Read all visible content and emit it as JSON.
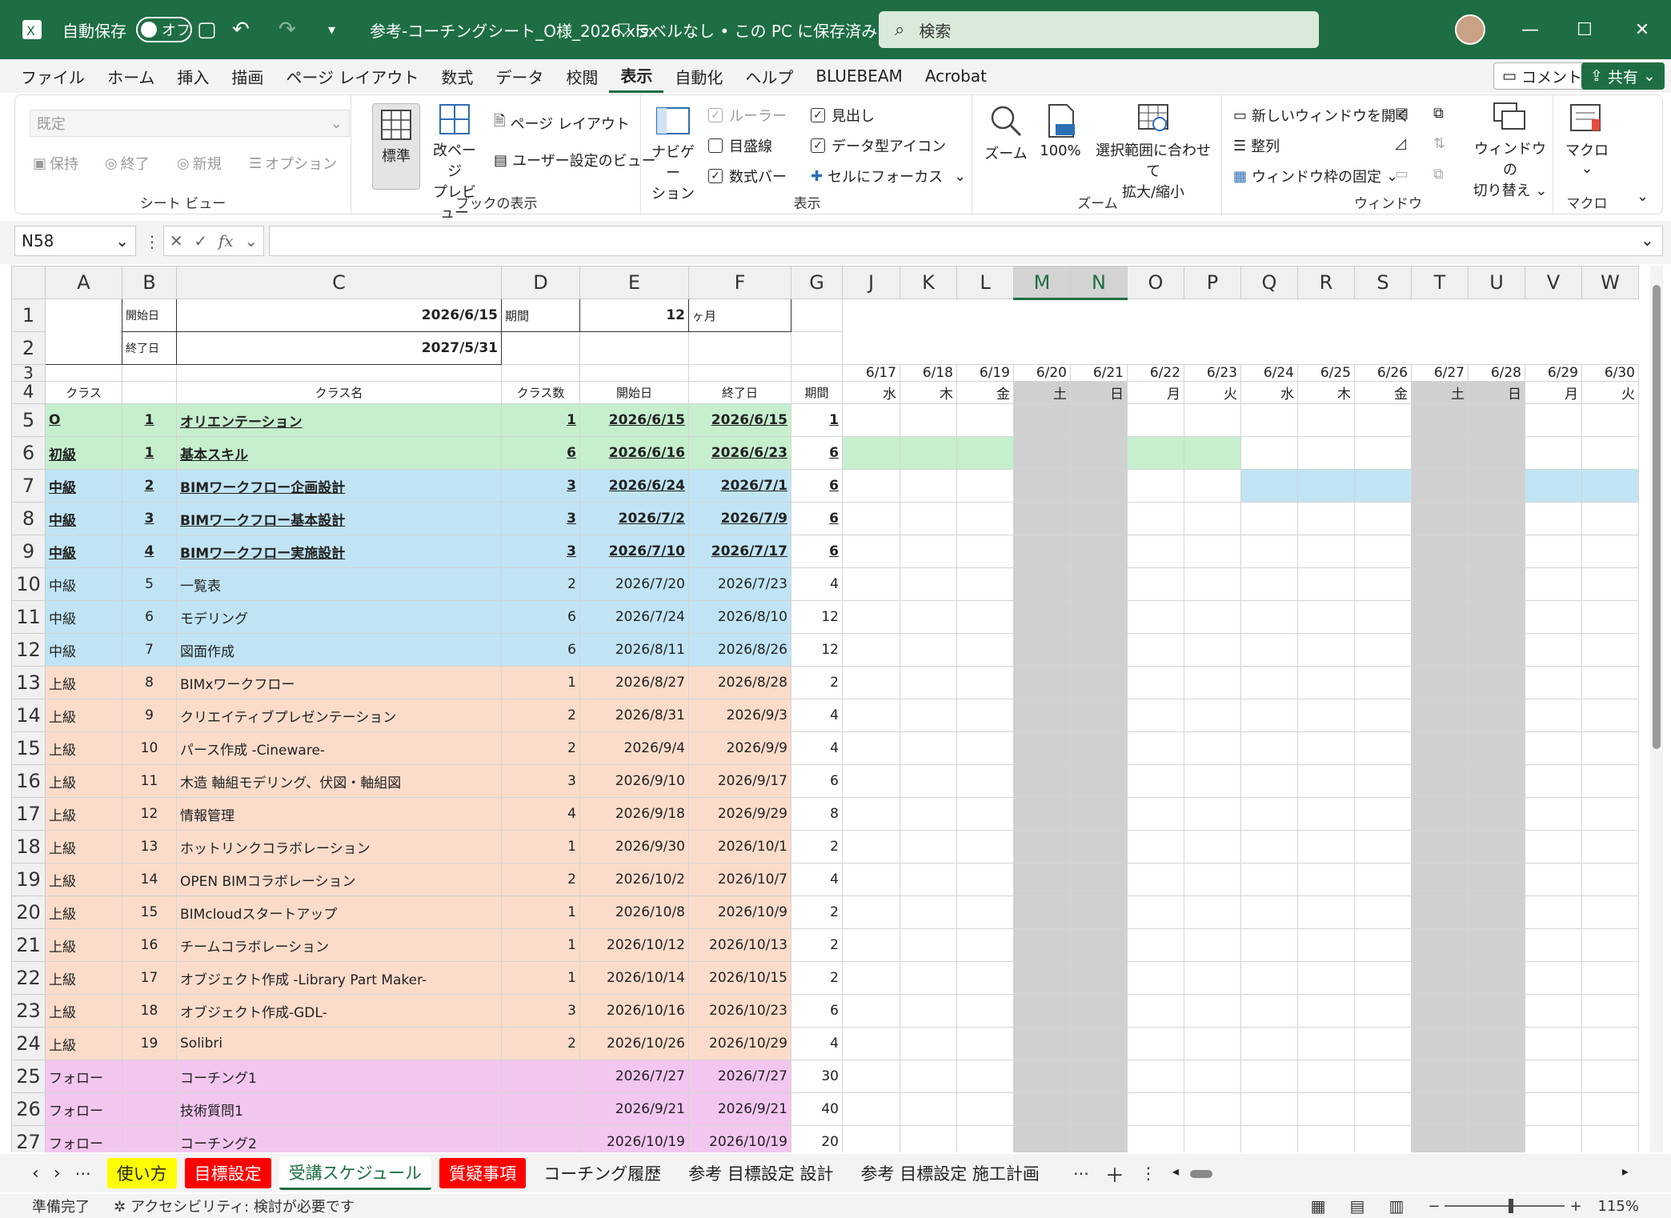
{
  "title_bar": {
    "autosave": "自動保存",
    "toggle": "オフ",
    "filename": "参考-コーチングシート_O様_2026.xlsx",
    "label": "ラベルなし • この PC に保存済み",
    "search": "検索"
  },
  "menu": [
    "ファイル",
    "ホーム",
    "挿入",
    "描画",
    "ページ レイアウト",
    "数式",
    "データ",
    "校閲",
    "表示",
    "自動化",
    "ヘルプ",
    "BLUEBEAM",
    "Acrobat"
  ],
  "menu_buttons": {
    "comment": "コメント",
    "share": "共有"
  },
  "ribbon": {
    "sheetview": {
      "select": "既定",
      "keep": "保持",
      "exit": "終了",
      "new": "新規",
      "options": "オプション",
      "label": "シート ビュー"
    },
    "book": {
      "normal": "標準",
      "pagebreak1": "改ページ",
      "pagebreak2": "プレビュー",
      "pagelayout": "ページ レイアウト",
      "custom": "ユーザー設定のビュー",
      "label": "ブックの表示"
    },
    "show": {
      "nav1": "ナビゲー",
      "nav2": "ション",
      "ruler": "ルーラー",
      "gridlines": "目盛線",
      "formulabar": "数式バー",
      "headings": "見出し",
      "datatype": "データ型アイコン",
      "focus": "セルにフォーカス",
      "label": "表示"
    },
    "zoom": {
      "zoom": "ズーム",
      "hundred": "100%",
      "sel1": "選択範囲に合わせて",
      "sel2": "拡大/縮小",
      "label": "ズーム"
    },
    "window": {
      "newwin": "新しいウィンドウを開く",
      "arrange": "整列",
      "freeze": "ウィンドウ枠の固定",
      "switch1": "ウィンドウの",
      "switch2": "切り替え",
      "label": "ウィンドウ"
    },
    "macro": {
      "macro": "マクロ",
      "label": "マクロ"
    }
  },
  "namebox": "N58",
  "fx": "fx",
  "col_headers": [
    "A",
    "B",
    "C",
    "D",
    "E",
    "F",
    "G",
    "J",
    "K",
    "L",
    "M",
    "N",
    "O",
    "P",
    "Q",
    "R",
    "S",
    "T",
    "U",
    "V",
    "W"
  ],
  "row1": {
    "rn": "1",
    "b": "開始日",
    "c": "2026/6/15",
    "d": "期間",
    "e": "12",
    "f": "ヶ月"
  },
  "row2": {
    "rn": "2",
    "b": "終了日",
    "c": "2027/5/31"
  },
  "row3": {
    "rn": "3",
    "dates": [
      "6/17",
      "6/18",
      "6/19",
      "6/20",
      "6/21",
      "6/22",
      "6/23",
      "6/24",
      "6/25",
      "6/26",
      "6/27",
      "6/28",
      "6/29",
      "6/30"
    ]
  },
  "row4": {
    "rn": "4",
    "a": "クラス",
    "c": "クラス名",
    "d": "クラス数",
    "e": "開始日",
    "f": "終了日",
    "g": "期間",
    "days": [
      "水",
      "木",
      "金",
      "土",
      "日",
      "月",
      "火",
      "水",
      "木",
      "金",
      "土",
      "日",
      "月",
      "火"
    ]
  },
  "rows": [
    {
      "rn": "5",
      "a": "O",
      "b": "1",
      "c": "オリエンテーション",
      "d": "1",
      "e": "2026/6/15",
      "f": "2026/6/15",
      "g": "1"
    },
    {
      "rn": "6",
      "a": "初級",
      "b": "1",
      "c": "基本スキル",
      "d": "6",
      "e": "2026/6/16",
      "f": "2026/6/23",
      "g": "6"
    },
    {
      "rn": "7",
      "a": "中級",
      "b": "2",
      "c": "BIMワークフロー企画設計",
      "d": "3",
      "e": "2026/6/24",
      "f": "2026/7/1",
      "g": "6"
    },
    {
      "rn": "8",
      "a": "中級",
      "b": "3",
      "c": "BIMワークフロー基本設計",
      "d": "3",
      "e": "2026/7/2",
      "f": "2026/7/9",
      "g": "6"
    },
    {
      "rn": "9",
      "a": "中級",
      "b": "4",
      "c": "BIMワークフロー実施設計",
      "d": "3",
      "e": "2026/7/10",
      "f": "2026/7/17",
      "g": "6"
    },
    {
      "rn": "10",
      "a": "中級",
      "b": "5",
      "c": "一覧表",
      "d": "2",
      "e": "2026/7/20",
      "f": "2026/7/23",
      "g": "4"
    },
    {
      "rn": "11",
      "a": "中級",
      "b": "6",
      "c": "モデリング",
      "d": "6",
      "e": "2026/7/24",
      "f": "2026/8/10",
      "g": "12"
    },
    {
      "rn": "12",
      "a": "中級",
      "b": "7",
      "c": "図面作成",
      "d": "6",
      "e": "2026/8/11",
      "f": "2026/8/26",
      "g": "12"
    },
    {
      "rn": "13",
      "a": "上級",
      "b": "8",
      "c": "BIMxワークフロー",
      "d": "1",
      "e": "2026/8/27",
      "f": "2026/8/28",
      "g": "2"
    },
    {
      "rn": "14",
      "a": "上級",
      "b": "9",
      "c": "クリエイティブプレゼンテーション",
      "d": "2",
      "e": "2026/8/31",
      "f": "2026/9/3",
      "g": "4"
    },
    {
      "rn": "15",
      "a": "上級",
      "b": "10",
      "c": "パース作成 -Cineware-",
      "d": "2",
      "e": "2026/9/4",
      "f": "2026/9/9",
      "g": "4"
    },
    {
      "rn": "16",
      "a": "上級",
      "b": "11",
      "c": "木造 軸組モデリング、伏図・軸組図",
      "d": "3",
      "e": "2026/9/10",
      "f": "2026/9/17",
      "g": "6"
    },
    {
      "rn": "17",
      "a": "上級",
      "b": "12",
      "c": "情報管理",
      "d": "4",
      "e": "2026/9/18",
      "f": "2026/9/29",
      "g": "8"
    },
    {
      "rn": "18",
      "a": "上級",
      "b": "13",
      "c": "ホットリンクコラボレーション",
      "d": "1",
      "e": "2026/9/30",
      "f": "2026/10/1",
      "g": "2"
    },
    {
      "rn": "19",
      "a": "上級",
      "b": "14",
      "c": "OPEN BIMコラボレーション",
      "d": "2",
      "e": "2026/10/2",
      "f": "2026/10/7",
      "g": "4"
    },
    {
      "rn": "20",
      "a": "上級",
      "b": "15",
      "c": "BIMcloudスタートアップ",
      "d": "1",
      "e": "2026/10/8",
      "f": "2026/10/9",
      "g": "2"
    },
    {
      "rn": "21",
      "a": "上級",
      "b": "16",
      "c": "チームコラボレーション",
      "d": "1",
      "e": "2026/10/12",
      "f": "2026/10/13",
      "g": "2"
    },
    {
      "rn": "22",
      "a": "上級",
      "b": "17",
      "c": "オブジェクト作成 -Library Part Maker-",
      "d": "1",
      "e": "2026/10/14",
      "f": "2026/10/15",
      "g": "2"
    },
    {
      "rn": "23",
      "a": "上級",
      "b": "18",
      "c": "オブジェクト作成-GDL-",
      "d": "3",
      "e": "2026/10/16",
      "f": "2026/10/23",
      "g": "6"
    },
    {
      "rn": "24",
      "a": "上級",
      "b": "19",
      "c": "Solibri",
      "d": "2",
      "e": "2026/10/26",
      "f": "2026/10/29",
      "g": "4"
    },
    {
      "rn": "25",
      "a": "フォロー",
      "b": "",
      "c": "コーチング1",
      "d": "",
      "e": "2026/7/27",
      "f": "2026/7/27",
      "g": "30"
    },
    {
      "rn": "26",
      "a": "フォロー",
      "b": "",
      "c": "技術質問1",
      "d": "",
      "e": "2026/9/21",
      "f": "2026/9/21",
      "g": "40"
    },
    {
      "rn": "27",
      "a": "フォロー",
      "b": "",
      "c": "コーチング2",
      "d": "",
      "e": "2026/10/19",
      "f": "2026/10/19",
      "g": "20"
    }
  ],
  "tabs": [
    "使い方",
    "目標設定",
    "受講スケジュール",
    "質疑事項",
    "コーチング履歴",
    "参考 目標設定 設計",
    "参考 目標設定 施工計画"
  ],
  "status": {
    "ready": "準備完了",
    "access": "アクセシビリティ: 検討が必要です",
    "zoom": "115%"
  }
}
